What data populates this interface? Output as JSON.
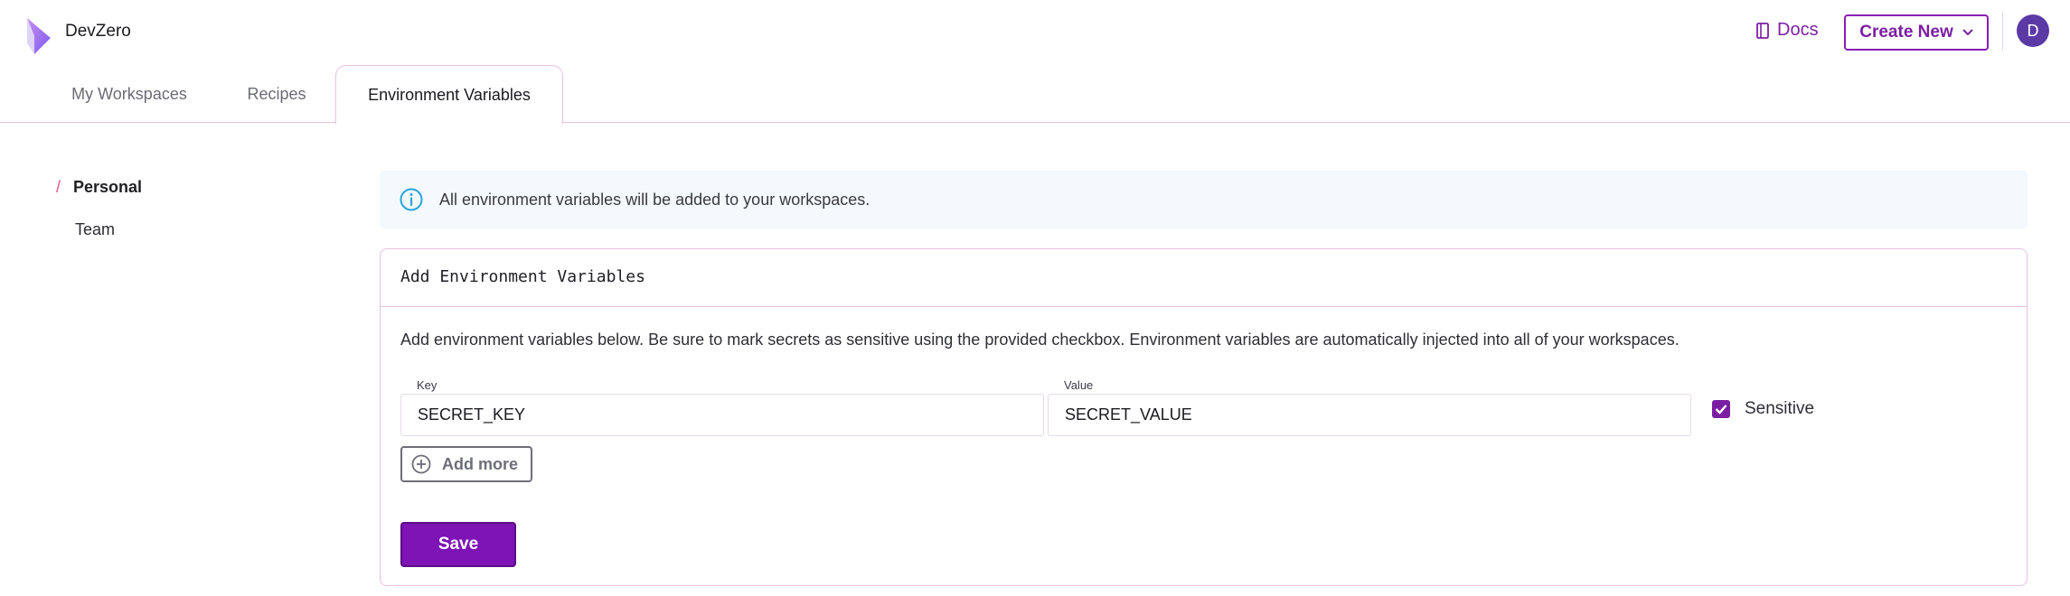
{
  "header": {
    "brand": "DevZero",
    "logo_icon": "devzero-logo",
    "docs_label": "Docs",
    "docs_icon": "book-icon",
    "create_label": "Create New",
    "avatar_initial": "D",
    "colors": {
      "accent": "#7b1fa2",
      "avatar": "#5b3aa6"
    }
  },
  "tabs": [
    {
      "label": "My Workspaces",
      "active": false
    },
    {
      "label": "Recipes",
      "active": false
    },
    {
      "label": "Environment Variables",
      "active": true
    }
  ],
  "sidebar": {
    "items": [
      {
        "label": "Personal",
        "active": true,
        "marker": "/"
      },
      {
        "label": "Team",
        "active": false
      }
    ]
  },
  "info": {
    "icon": "info-icon",
    "text": "All environment variables will be added to your workspaces."
  },
  "card": {
    "title": "Add Environment Variables",
    "description": "Add environment variables below. Be sure to mark secrets as sensitive using the provided checkbox. Environment variables are automatically injected into all of your workspaces.",
    "key_label": "Key",
    "key_value": "SECRET_KEY",
    "value_label": "Value",
    "value_value": "SECRET_VALUE",
    "sensitive_label": "Sensitive",
    "sensitive_checked": true,
    "add_more_label": "Add more",
    "save_label": "Save"
  }
}
